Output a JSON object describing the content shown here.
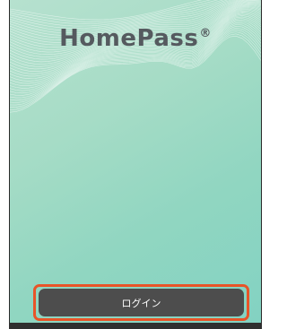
{
  "app": {
    "logo_text": "HomePass",
    "logo_mark": "®"
  },
  "login": {
    "label": "ログイン"
  },
  "colors": {
    "background_start": "#b6e1cf",
    "background_end": "#82d2c2",
    "button": "#4d4d4d",
    "highlight": "#e85428",
    "logo": "#555a5f"
  }
}
